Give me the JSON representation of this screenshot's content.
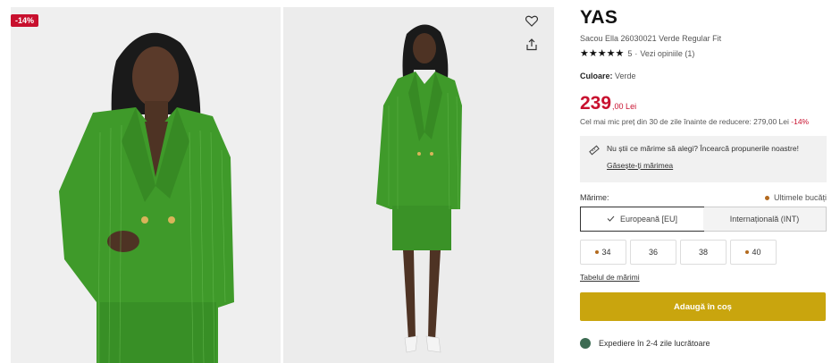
{
  "gallery": {
    "discount_badge": "-14%",
    "favorite_icon": "heart-icon",
    "share_icon": "share-icon"
  },
  "product": {
    "brand": "YAS",
    "name": "Sacou Ella 26030021 Verde Regular Fit",
    "rating": {
      "stars": "★★★★★",
      "score": "5",
      "separator": "·",
      "reviews_link": "Vezi opiniile (1)"
    },
    "color": {
      "label": "Culoare:",
      "value": "Verde"
    },
    "price": {
      "integer": "239",
      "decimals": ",00 Lei",
      "note": "Cel mai mic preț din 30 de zile înainte de reducere: 279,00 Lei",
      "discount": "-14%"
    }
  },
  "size_help": {
    "icon": "ruler-icon",
    "text": "Nu știi ce mărime să alegi? Încearcă propunerile noastre!",
    "link": "Găsește-ți mărimea"
  },
  "size_section": {
    "label": "Mărime:",
    "last_items": "Ultimele bucăți",
    "tabs": [
      {
        "label": "Europeană [EU]",
        "active": true
      },
      {
        "label": "Internațională (INT)",
        "active": false
      }
    ],
    "sizes": [
      {
        "label": "34",
        "low_stock": true
      },
      {
        "label": "36",
        "low_stock": false
      },
      {
        "label": "38",
        "low_stock": false
      },
      {
        "label": "40",
        "low_stock": true
      }
    ],
    "size_table_link": "Tabelul de mărimi"
  },
  "add_to_cart": "Adaugă în coș",
  "shipping": "Expediere în 2-4 zile lucrătoare",
  "colors": {
    "accent_red": "#c8102e",
    "cart_button": "#c9a50e",
    "low_stock_dot": "#b36a1f",
    "shipping_dot": "#3c6b52",
    "jacket_green": "#3f9a2a"
  }
}
